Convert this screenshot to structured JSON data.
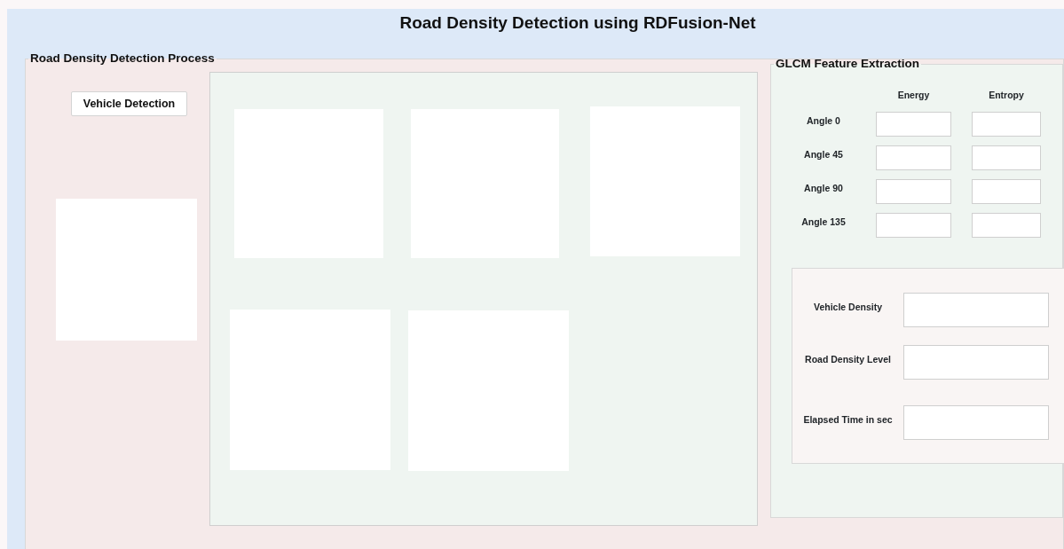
{
  "window": {
    "title": "Road Density Detection using RDFusion-Net"
  },
  "process_panel": {
    "title": "Road Density Detection Process",
    "button": "Vehicle Detection"
  },
  "glcm_panel": {
    "title": "GLCM Feature Extraction",
    "columns": [
      "Energy",
      "Entropy"
    ],
    "rows": [
      {
        "label": "Angle 0"
      },
      {
        "label": "Angle 45"
      },
      {
        "label": "Angle 90"
      },
      {
        "label": "Angle 135"
      }
    ]
  },
  "results": [
    {
      "label": "Vehicle Density"
    },
    {
      "label": "Road Density Level"
    },
    {
      "label": "Elapsed Time in sec"
    }
  ]
}
